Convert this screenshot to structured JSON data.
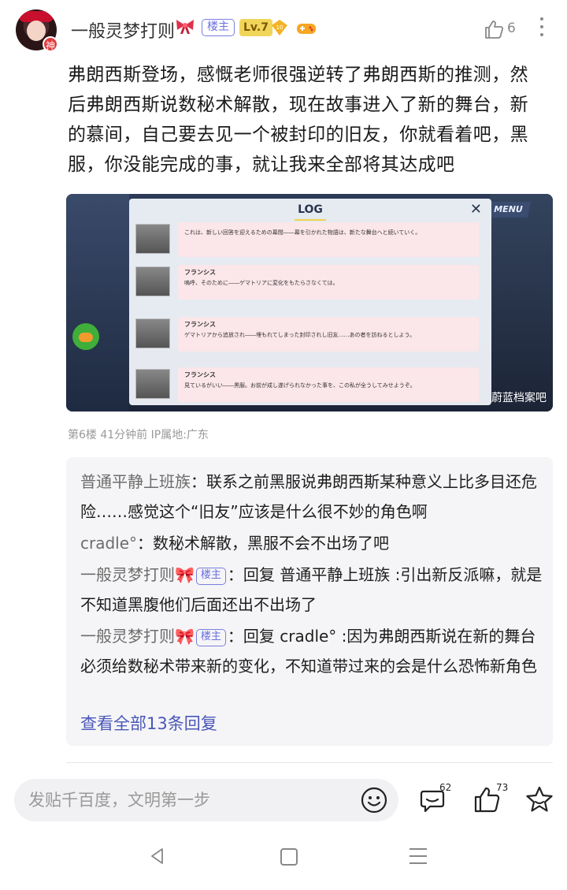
{
  "post": {
    "username": "一般灵梦打则",
    "louzhu_label": "楼主",
    "level": "Lv.7",
    "medal_number": "10",
    "god_badge": "神",
    "like_count": "6",
    "body": "弗朗西斯登场，感慨老师很强逆转了弗朗西斯的推测，然后弗朗西斯说数秘术解散，现在故事进入了新的舞台，新的慕间，自己要去见一个被封印的旧友，你就看着吧，黑服，你没能完成的事，就让我来全部将其达成吧",
    "meta": "第6楼  41分钟前  IP属地:广东"
  },
  "image": {
    "log_title": "LOG",
    "close_label": "✕",
    "menu_label": "MENU",
    "watermark": "蔚蓝档案吧",
    "entries": [
      {
        "name": "",
        "text": "これは、新しい回答を迎えるための幕間――幕を引かれた物語は、新たな舞台へと続いていく。"
      },
      {
        "name": "フランシス",
        "text": "嗚呼、そのために――ゲマトリアに変化をもたらさなくては。"
      },
      {
        "name": "フランシス",
        "text": "ゲマトリアから追放され――埋もれてしまった封印されし旧友……あの者を訪ねるとしよう。"
      },
      {
        "name": "フランシス",
        "text": "見ているがいい――黒服。お前が成し遂げられなかった事を、この私が全うしてみせようぞ。"
      }
    ]
  },
  "replies": [
    {
      "who": "普通平静上班族",
      "tag": "",
      "text": "：联系之前黑服说弗朗西斯某种意义上比多目还危险……感觉这个“旧友”应该是什么很不妙的角色啊"
    },
    {
      "who": "cradle°",
      "tag": "",
      "text": "：数秘术解散，黑服不会不出场了吧"
    },
    {
      "who": "一般灵梦打则🎀",
      "tag": "楼主",
      "text": "：回复 普通平静上班族 :引出新反派嘛，就是不知道黑腹他们后面还出不出场了"
    },
    {
      "who": "一般灵梦打则🎀",
      "tag": "楼主",
      "text": "：回复 cradle° :因为弗朗西斯说在新的舞台必须给数秘术带来新的变化，不知道带过来的会是什么恐怖新角色"
    }
  ],
  "see_all": "查看全部13条回复",
  "bottom_bar": {
    "placeholder": "发贴千百度，文明第一步",
    "comment_count": "62",
    "like_count": "73"
  }
}
